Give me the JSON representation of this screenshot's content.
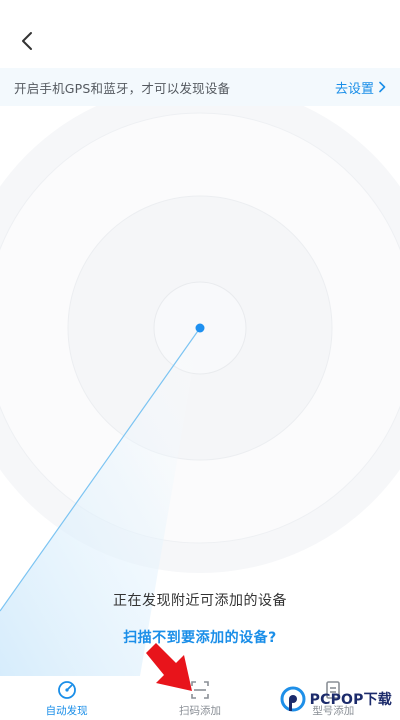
{
  "header": {
    "back_icon": "chevron-left-icon"
  },
  "banner": {
    "text": "开启手机GPS和蓝牙，才可以发现设备",
    "link_label": "去设置",
    "link_icon": "chevron-right-icon"
  },
  "scan": {
    "status_text": "正在发现附近可添加的设备",
    "help_link": "扫描不到要添加的设备?"
  },
  "tabs": [
    {
      "label": "自动发现",
      "icon": "radar-icon",
      "active": true
    },
    {
      "label": "扫码添加",
      "icon": "scan-icon",
      "active": false
    },
    {
      "label": "型号添加",
      "icon": "model-icon",
      "active": false
    }
  ],
  "watermark": {
    "text": "PCPOP下载"
  },
  "colors": {
    "accent": "#1a8ee8",
    "banner_bg": "#f3f9fd",
    "arrow": "#e8141b",
    "dot": "#1e90f0"
  }
}
